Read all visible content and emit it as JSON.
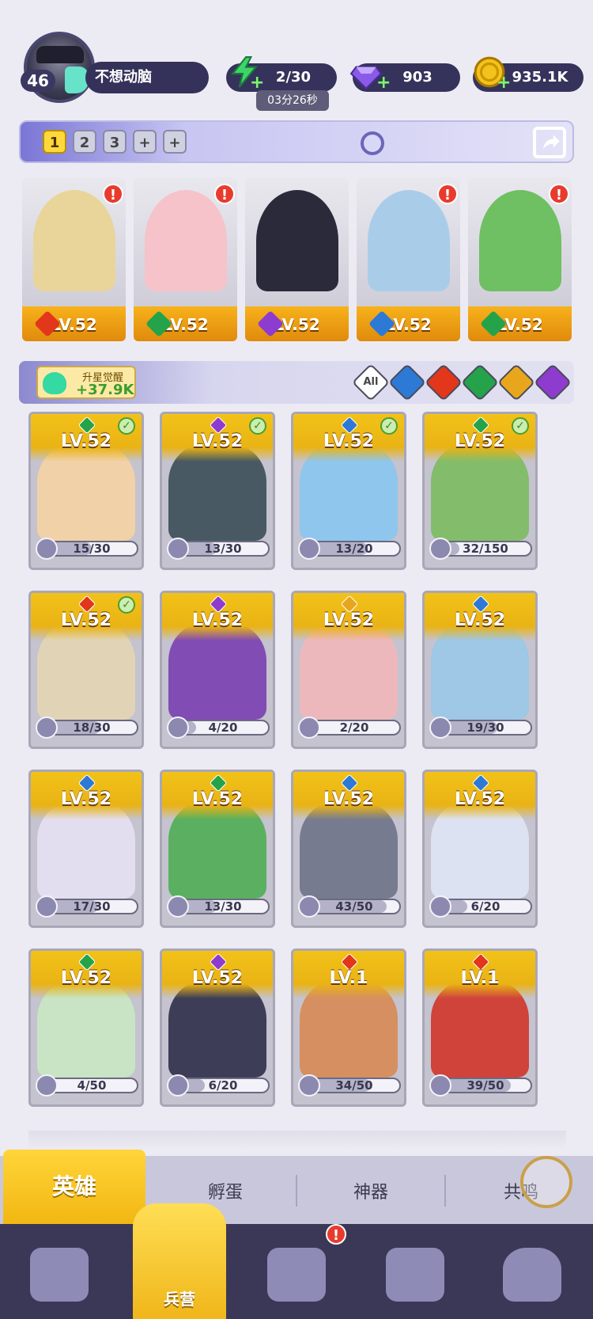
{
  "player": {
    "level": "46",
    "name": "不想动脑"
  },
  "resources": {
    "stamina": "2/30",
    "stamina_timer": "03分26秒",
    "gems": "903",
    "gold": "935.1K"
  },
  "team_tabs": [
    "1",
    "2",
    "3"
  ],
  "team": [
    {
      "level": "LV.52",
      "element_color": "#e2371b",
      "art_color": "#e9d59a",
      "alert": true
    },
    {
      "level": "LV.52",
      "element_color": "#25a34a",
      "art_color": "#f5c3c9",
      "alert": true
    },
    {
      "level": "LV.52",
      "element_color": "#8d3ccf",
      "art_color": "#2a2a3a",
      "alert": false
    },
    {
      "level": "LV.52",
      "element_color": "#2d79d6",
      "art_color": "#a9cde9",
      "alert": true
    },
    {
      "level": "LV.52",
      "element_color": "#25a34a",
      "art_color": "#6fbf63",
      "alert": true
    }
  ],
  "awaken": {
    "title": "升星觉醒",
    "value": "+37.9K"
  },
  "filters": {
    "all_label": "All",
    "colors": [
      "#2d79d6",
      "#e2371b",
      "#25a34a",
      "#e8a61c",
      "#8d3ccf"
    ]
  },
  "heroes": [
    {
      "level": "LV.52",
      "element_color": "#25a34a",
      "art_color": "#f6d3a2",
      "checked": true,
      "fragments": "15/30",
      "progress": 0.5
    },
    {
      "level": "LV.52",
      "element_color": "#8d3ccf",
      "art_color": "#3b4e56",
      "checked": true,
      "fragments": "13/30",
      "progress": 0.43
    },
    {
      "level": "LV.52",
      "element_color": "#2d79d6",
      "art_color": "#8ac7ef",
      "checked": true,
      "fragments": "13/20",
      "progress": 0.65
    },
    {
      "level": "LV.52",
      "element_color": "#25a34a",
      "art_color": "#7cbd5f",
      "checked": true,
      "fragments": "32/150",
      "progress": 0.21
    },
    {
      "level": "LV.52",
      "element_color": "#e2371b",
      "art_color": "#e4d6b2",
      "checked": true,
      "fragments": "18/30",
      "progress": 0.6
    },
    {
      "level": "LV.52",
      "element_color": "#8d3ccf",
      "art_color": "#7a3fb0",
      "checked": false,
      "fragments": "4/20",
      "progress": 0.2
    },
    {
      "level": "LV.52",
      "element_color": "#e8a61c",
      "art_color": "#f2b7b9",
      "checked": false,
      "fragments": "2/20",
      "progress": 0.1
    },
    {
      "level": "LV.52",
      "element_color": "#2d79d6",
      "art_color": "#9bc8e8",
      "checked": false,
      "fragments": "19/30",
      "progress": 0.63
    },
    {
      "level": "LV.52",
      "element_color": "#2d79d6",
      "art_color": "#e7e1f2",
      "checked": false,
      "fragments": "17/30",
      "progress": 0.57
    },
    {
      "level": "LV.52",
      "element_color": "#25a34a",
      "art_color": "#4fae53",
      "checked": false,
      "fragments": "13/30",
      "progress": 0.43
    },
    {
      "level": "LV.52",
      "element_color": "#2d79d6",
      "art_color": "#6f7388",
      "checked": false,
      "fragments": "43/50",
      "progress": 0.86
    },
    {
      "level": "LV.52",
      "element_color": "#2d79d6",
      "art_color": "#dfe6f5",
      "checked": false,
      "fragments": "6/20",
      "progress": 0.3
    },
    {
      "level": "LV.52",
      "element_color": "#25a34a",
      "art_color": "#c9e8c2",
      "checked": false,
      "fragments": "4/50",
      "progress": 0.08
    },
    {
      "level": "LV.52",
      "element_color": "#8d3ccf",
      "art_color": "#2f2f4a",
      "checked": false,
      "fragments": "6/20",
      "progress": 0.3
    },
    {
      "level": "LV.1",
      "element_color": "#e2371b",
      "art_color": "#d88a54",
      "checked": false,
      "fragments": "34/50",
      "progress": 0.68
    },
    {
      "level": "LV.1",
      "element_color": "#e2371b",
      "art_color": "#d0352a",
      "checked": false,
      "fragments": "39/50",
      "progress": 0.78
    }
  ],
  "sub_tabs": [
    "英雄",
    "孵蛋",
    "神器",
    "共鸣"
  ],
  "nav": {
    "barracks_label": "兵营",
    "alert_glyph": "!"
  },
  "alert_glyph": "!",
  "plus_glyph": "+",
  "check_glyph": "✓"
}
